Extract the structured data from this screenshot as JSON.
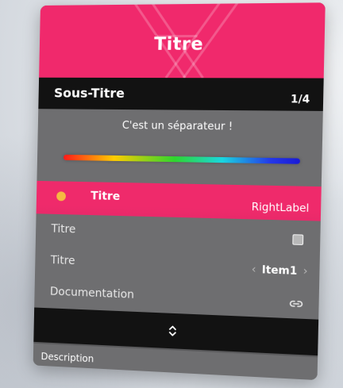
{
  "menu": {
    "header_title": "Titre",
    "subtitle": "Sous-Titre",
    "counter": "1/4",
    "separator_text": "C'est un séparateur !",
    "items": [
      {
        "label": "Titre",
        "right_label": "RightLabel",
        "selected": true,
        "badge_color": "#f5b942"
      },
      {
        "label": "Titre",
        "type": "checkbox",
        "checked": false
      },
      {
        "label": "Titre",
        "type": "list",
        "value": "Item1"
      },
      {
        "label": "Documentation",
        "type": "link",
        "icon": "link-icon"
      }
    ],
    "scroll_icon": "chevron-up-down-icon",
    "description": "Description"
  },
  "colors": {
    "accent": "#f0296c",
    "panel": "#6e6e70",
    "bar": "#121212",
    "badge": "#f5b942"
  }
}
